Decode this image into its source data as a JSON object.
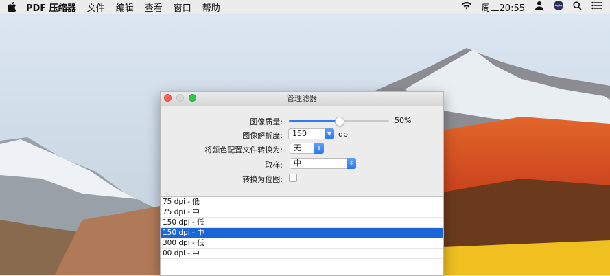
{
  "menubar": {
    "app_name": "PDF 压缩器",
    "menus": [
      "文件",
      "编辑",
      "查看",
      "窗口",
      "帮助"
    ],
    "clock": "周二20:55"
  },
  "window": {
    "title": "管理滤器",
    "form": {
      "image_quality": {
        "label": "图像质量:",
        "value_label": "50%",
        "fraction": 0.5
      },
      "image_resolution": {
        "label": "图像解析度:",
        "value": "150",
        "unit": "dpi"
      },
      "color_profile": {
        "label": "将颜色配置文件转换为:",
        "value": "无"
      },
      "sampling": {
        "label": "取样:",
        "value": "中"
      },
      "convert_bitmap": {
        "label": "转换为位图:",
        "checked": false
      }
    },
    "list": {
      "items": [
        "75 dpi - 低",
        "75 dpi - 中",
        "150 dpi - 低",
        "150 dpi - 中",
        "300 dpi - 低",
        "00 dpi - 中"
      ],
      "selected_index": 3
    }
  },
  "colors": {
    "accent": "#2f7bf5",
    "selection": "#1a66d6"
  }
}
